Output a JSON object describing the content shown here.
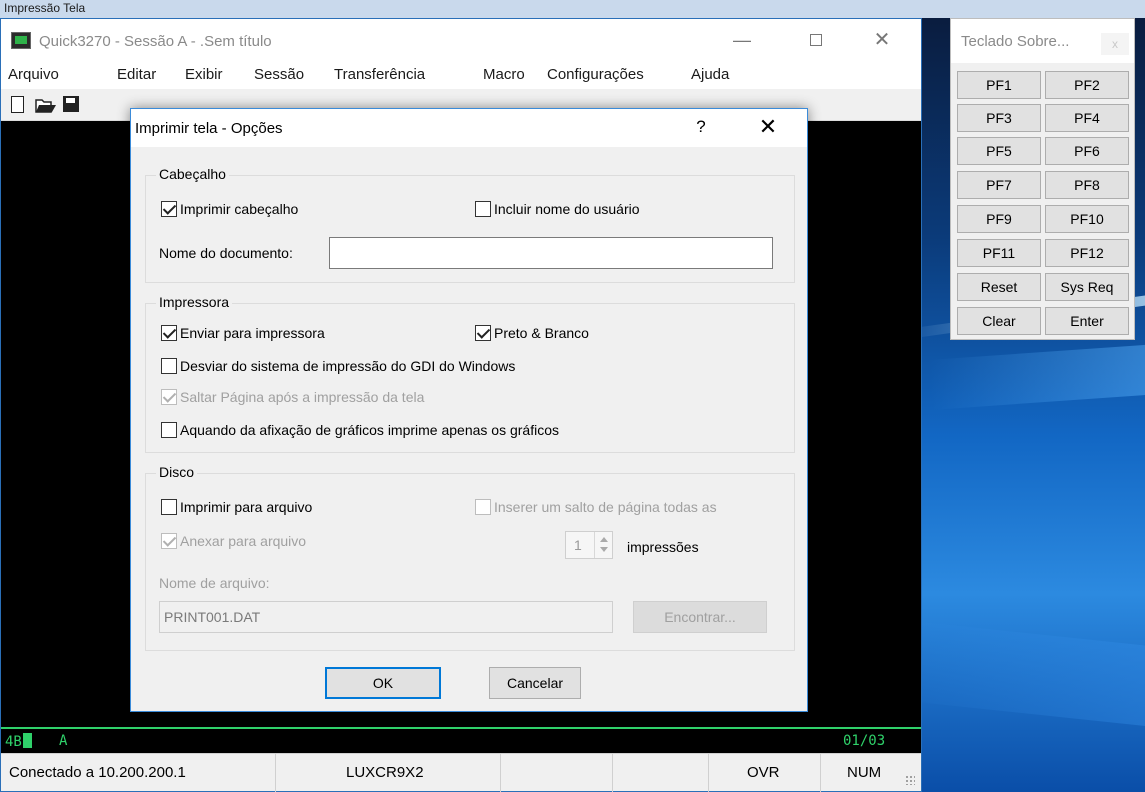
{
  "main_window": {
    "title": "Quick3270 - Sessão A - .Sem título",
    "menu": [
      "Arquivo",
      "Editar",
      "Exibir",
      "Sessão",
      "Transferência",
      "Macro",
      "Configurações",
      "Ajuda"
    ],
    "oia": {
      "left": "4B",
      "indicator": "A",
      "cursor_pos": "01/03"
    },
    "status": {
      "connection": "Conectado a 10.200.200.1",
      "lu": "LUXCR9X2",
      "mode": "OVR",
      "num": "NUM"
    }
  },
  "dialog": {
    "title": "Imprimir tela - Opções",
    "help": "?",
    "header_group": {
      "label": "Cabeçalho",
      "print_header": {
        "label": "Imprimir cabeçalho",
        "checked": true
      },
      "include_user": {
        "label": "Incluir nome do usuário",
        "checked": false
      },
      "doc_name_label": "Nome do documento:",
      "doc_name_value": ""
    },
    "printer_group": {
      "label": "Impressora",
      "send_to_printer": {
        "label": "Enviar para impressora",
        "checked": true
      },
      "black_white": {
        "label": "Preto & Branco",
        "checked": true
      },
      "bypass_gdi": {
        "label": "Desviar do sistema de impressão do GDI do Windows",
        "checked": false
      },
      "page_break": {
        "label": "Saltar Página após a impressão da tela",
        "checked": true,
        "disabled": true
      },
      "graphics_only": {
        "label": "Aquando da afixação de gráficos imprime apenas os gráficos",
        "checked": false
      }
    },
    "disk_group": {
      "label": "Disco",
      "print_to_file": {
        "label": "Imprimir para arquivo",
        "checked": false
      },
      "append_to_file": {
        "label": "Anexar para arquivo",
        "checked": true,
        "disabled": true
      },
      "insert_page_break": {
        "label": "Inserer um salto de página todas as",
        "checked": false,
        "disabled": true
      },
      "spin_value": "1",
      "spin_suffix": "impressões",
      "file_name_label": "Nome de arquivo:",
      "file_name_value": "PRINT001.DAT",
      "find_button": "Encontrar..."
    },
    "ok_button": "OK",
    "cancel_button": "Cancelar"
  },
  "keypad": {
    "title": "Teclado Sobre...",
    "close": "x",
    "keys": [
      "PF1",
      "PF2",
      "PF3",
      "PF4",
      "PF5",
      "PF6",
      "PF7",
      "PF8",
      "PF9",
      "PF10",
      "PF11",
      "PF12",
      "Reset",
      "Sys Req",
      "Clear",
      "Enter"
    ]
  },
  "top_strip_text": "Impressão Tela"
}
